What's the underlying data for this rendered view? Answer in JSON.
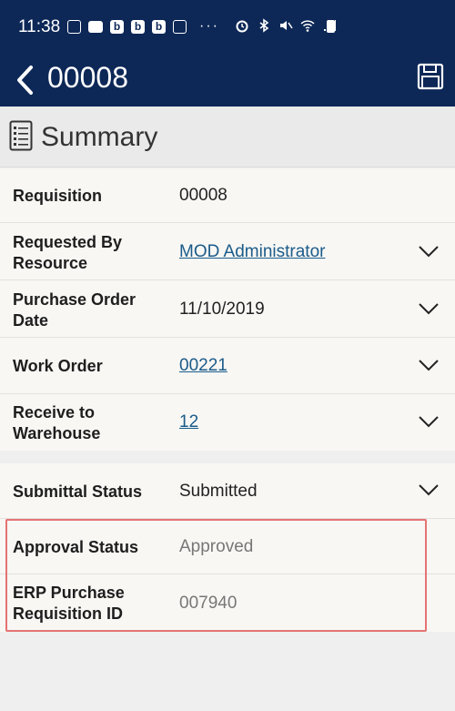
{
  "status_bar": {
    "time": "11:38",
    "more": "···"
  },
  "app_bar": {
    "title": "00008",
    "back_icon": "chevron-left-icon",
    "save_icon": "save-icon"
  },
  "summary": {
    "title": "Summary",
    "icon": "list-document-icon"
  },
  "fields": [
    {
      "label": "Requisition",
      "value": "00008"
    },
    {
      "label": "Requested By Resource",
      "value": "MOD Administrator"
    },
    {
      "label": "Purchase Order Date",
      "value": "11/10/2019"
    },
    {
      "label": "Work Order",
      "value": "00221"
    },
    {
      "label": "Receive to Warehouse",
      "value": "12"
    }
  ],
  "status_fields": [
    {
      "label": "Submittal Status",
      "value": "Submitted"
    },
    {
      "label": "Approval Status",
      "value": "Approved"
    },
    {
      "label": "ERP Purchase Requisition ID",
      "value": "007940"
    }
  ],
  "colors": {
    "header": "#0d2857",
    "link": "#1b5b8a",
    "highlight": "#e57373",
    "background": "#efefef"
  }
}
